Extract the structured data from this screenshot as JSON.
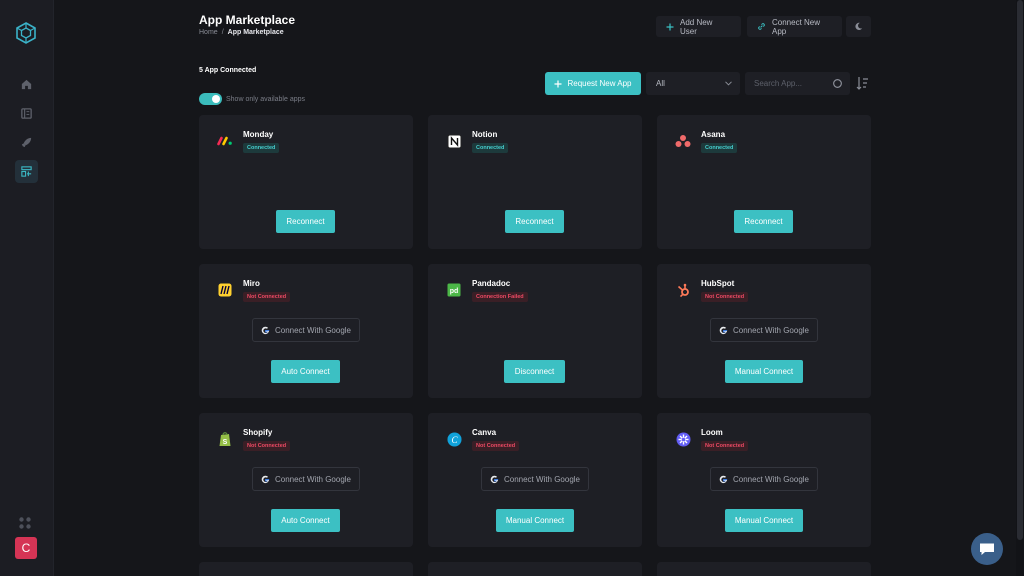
{
  "header": {
    "title": "App Marketplace",
    "breadcrumb": {
      "home": "Home",
      "separator": "/",
      "current": "App Marketplace"
    },
    "add_user_label": "Add New User",
    "connect_app_label": "Connect New App"
  },
  "toolbar": {
    "connected_count": "5 App Connected",
    "toggle_label": "Show only available apps",
    "toggle_on": true,
    "request_label": "Request New App",
    "filter_value": "All",
    "search_placeholder": "Search App..."
  },
  "sidebar": {
    "items": [
      {
        "icon": "home-icon"
      },
      {
        "icon": "ledger-icon"
      },
      {
        "icon": "rocket-icon"
      },
      {
        "icon": "marketplace-icon",
        "active": true
      }
    ],
    "avatar_letter": "C"
  },
  "apps": [
    {
      "name": "Monday",
      "status": "Connected",
      "status_type": "ok",
      "google_label": "",
      "action": "Reconnect"
    },
    {
      "name": "Notion",
      "status": "Connected",
      "status_type": "ok",
      "google_label": "",
      "action": "Reconnect"
    },
    {
      "name": "Asana",
      "status": "Connected",
      "status_type": "ok",
      "google_label": "",
      "action": "Reconnect"
    },
    {
      "name": "Miro",
      "status": "Not Connected",
      "status_type": "bad",
      "google_label": "Connect With Google",
      "action": "Auto Connect"
    },
    {
      "name": "Pandadoc",
      "status": "Connection Failed",
      "status_type": "bad",
      "google_label": "",
      "action": "Disconnect"
    },
    {
      "name": "HubSpot",
      "status": "Not Connected",
      "status_type": "bad",
      "google_label": "Connect With Google",
      "action": "Manual Connect"
    },
    {
      "name": "Shopify",
      "status": "Not Connected",
      "status_type": "bad",
      "google_label": "Connect With Google",
      "action": "Auto Connect"
    },
    {
      "name": "Canva",
      "status": "Not Connected",
      "status_type": "bad",
      "google_label": "Connect With Google",
      "action": "Manual Connect"
    },
    {
      "name": "Loom",
      "status": "Not Connected",
      "status_type": "bad",
      "google_label": "Connect With Google",
      "action": "Manual Connect"
    }
  ],
  "colors": {
    "accent": "#3cc0c3",
    "danger": "#ef4a64",
    "background": "#15161a",
    "card": "#1e1f25"
  }
}
